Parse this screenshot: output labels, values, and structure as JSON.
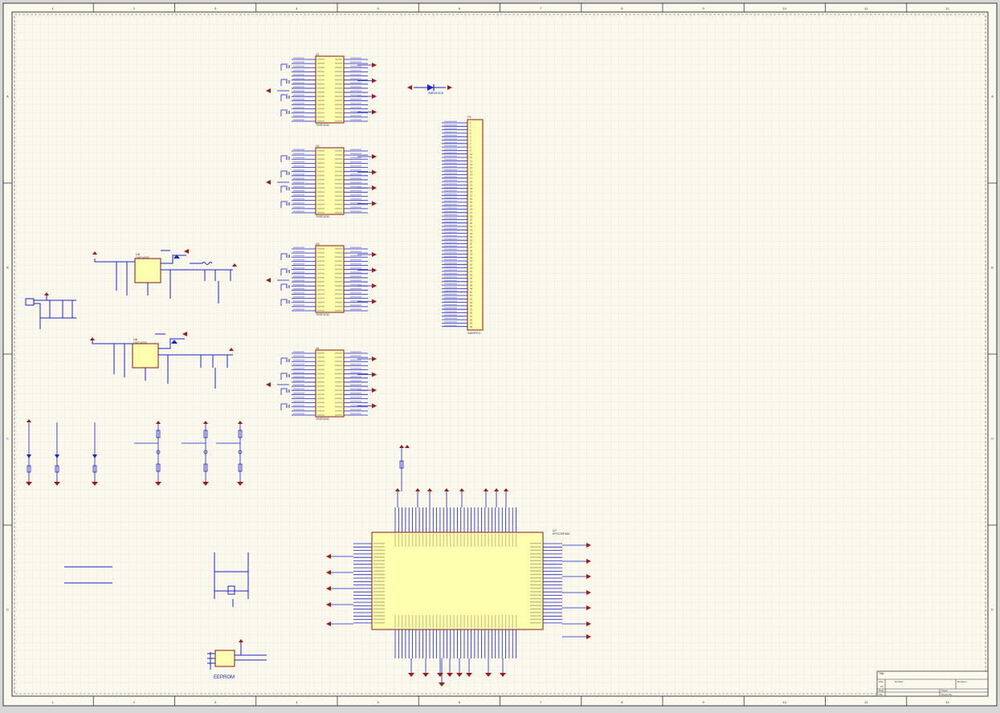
{
  "sheet": {
    "paper_color": "#fbf8ee",
    "border_color": "#3a3a3a",
    "wire_color": "#1a24c8",
    "part_fill": "#ffffb0",
    "part_stroke": "#8a1a1a",
    "power_color": "#a11a1a",
    "col_numbers": [
      "1",
      "2",
      "3",
      "4",
      "5",
      "6",
      "7",
      "8",
      "9",
      "10",
      "11",
      "12"
    ],
    "row_letters": [
      "A",
      "B",
      "C",
      "D"
    ]
  },
  "components": {
    "u1": {
      "ref": "U1",
      "value": "TRSF3232"
    },
    "u2": {
      "ref": "U2",
      "value": "TRSF3232"
    },
    "u3": {
      "ref": "U3",
      "value": "TRSF3232"
    },
    "u4": {
      "ref": "U4",
      "value": "TRSF3232"
    },
    "p1": {
      "ref": "P1",
      "value": "SAMTEC"
    },
    "u5": {
      "ref": "U5",
      "value": "LMZ14203"
    },
    "u6": {
      "ref": "U6",
      "value": "LMZ14203"
    },
    "u7": {
      "ref": "U7",
      "value": "EP2C20F484"
    },
    "eeprom_label": "EEPROM",
    "diode": "SMBJ5.0CA"
  },
  "title_block": {
    "title_label": "Title",
    "size_label": "Size",
    "size_value": "A3",
    "number_label": "Number",
    "revision_label": "Revision",
    "date_label": "Date",
    "file_label": "File",
    "sheet_label": "Sheet",
    "of_label": "of",
    "drawn_label": "Drawn By"
  },
  "power": {
    "gnd": "GND",
    "vcc": "+3V3",
    "v5": "+5V"
  }
}
